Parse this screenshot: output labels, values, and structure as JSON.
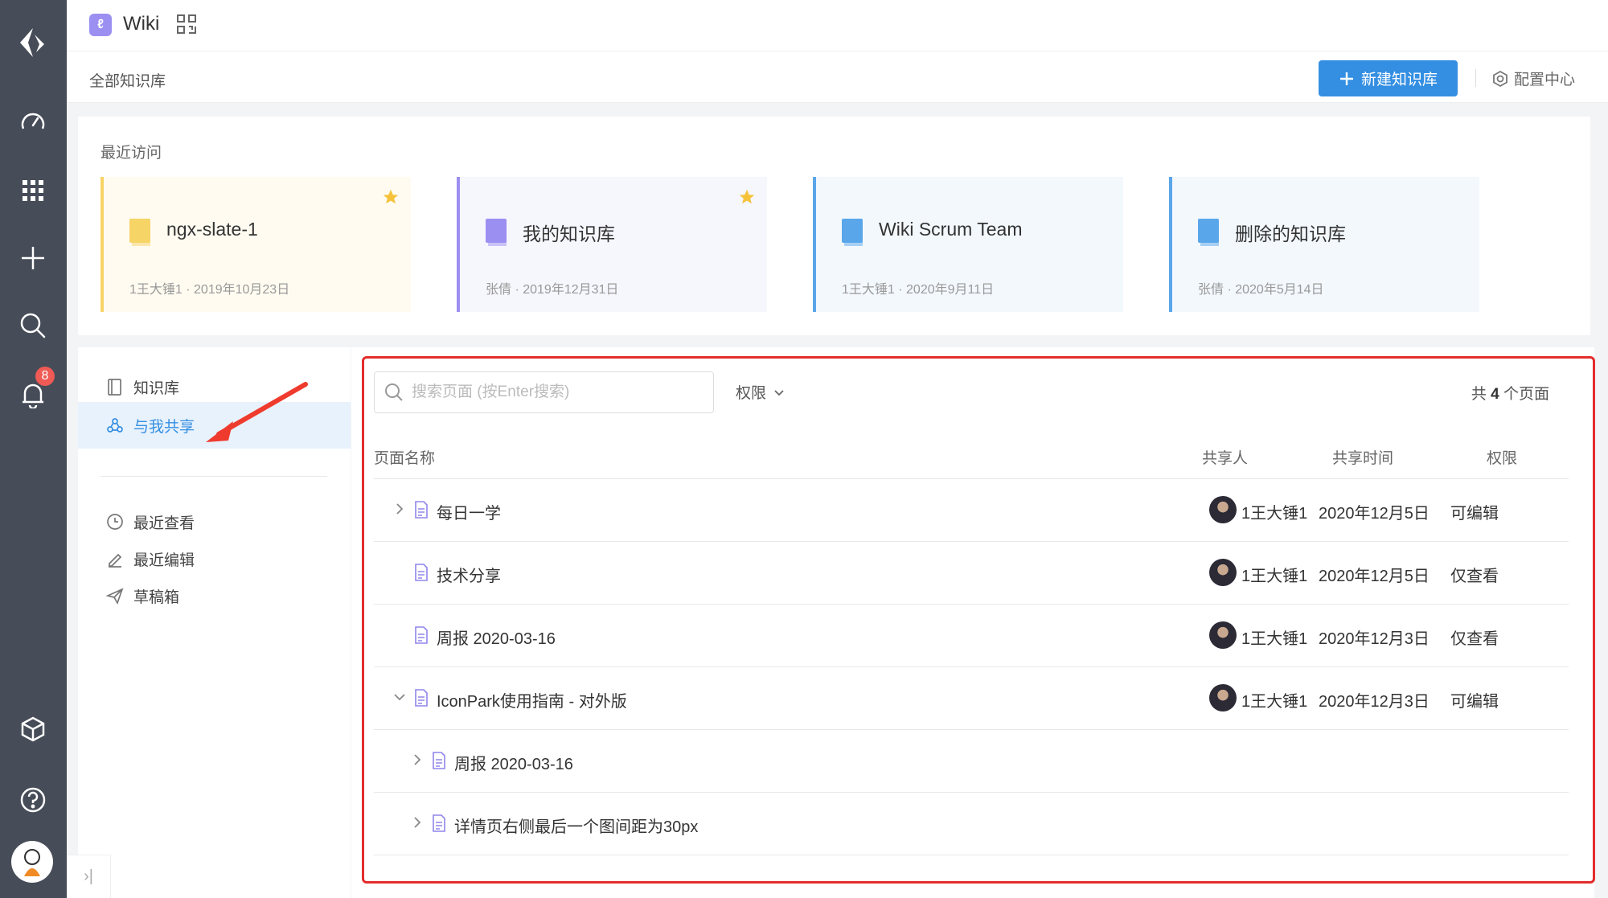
{
  "app": {
    "title": "Wiki"
  },
  "rail": {
    "badge_count": "8"
  },
  "subbar": {
    "title": "全部知识库",
    "new_button": "新建知识库",
    "config": "配置中心"
  },
  "recent": {
    "title": "最近访问",
    "cards": [
      {
        "name": "ngx-slate-1",
        "meta": "1王大锤1 · 2019年10月23日",
        "starred": true,
        "accent": "#f7d466",
        "bg": "#fffbf0"
      },
      {
        "name": "我的知识库",
        "meta": "张倩 · 2019年12月31日",
        "starred": true,
        "accent": "#9b8ff2",
        "bg": "#f6f6fd"
      },
      {
        "name": "Wiki Scrum Team",
        "meta": "1王大锤1 · 2020年9月11日",
        "starred": false,
        "accent": "#5aa6ea",
        "bg": "#f3f8fd"
      },
      {
        "name": "删除的知识库",
        "meta": "张倩 · 2020年5月14日",
        "starred": false,
        "accent": "#5aa6ea",
        "bg": "#f3f8fd"
      }
    ]
  },
  "nav": {
    "items": [
      {
        "label": "知识库",
        "icon": "book-icon",
        "active": false
      },
      {
        "label": "与我共享",
        "icon": "share-icon",
        "active": true
      },
      {
        "label": "最近查看",
        "icon": "clock-icon",
        "active": false
      },
      {
        "label": "最近编辑",
        "icon": "edit-icon",
        "active": false
      },
      {
        "label": "草稿箱",
        "icon": "send-icon",
        "active": false
      }
    ]
  },
  "list": {
    "search_placeholder": "搜索页面 (按Enter搜索)",
    "permission_filter": "权限",
    "total_prefix": "共",
    "total_count": "4",
    "total_suffix": "个页面",
    "columns": {
      "name": "页面名称",
      "sharer": "共享人",
      "time": "共享时间",
      "permission": "权限"
    },
    "rows": [
      {
        "title": "每日一学",
        "chevron": "right",
        "level": 0,
        "sharer": "1王大锤1",
        "time": "2020年12月5日",
        "permission": "可编辑"
      },
      {
        "title": "技术分享",
        "chevron": "none",
        "level": 0,
        "sharer": "1王大锤1",
        "time": "2020年12月5日",
        "permission": "仅查看"
      },
      {
        "title": "周报 2020-03-16",
        "chevron": "none",
        "level": 0,
        "sharer": "1王大锤1",
        "time": "2020年12月3日",
        "permission": "仅查看"
      },
      {
        "title": "IconPark使用指南 - 对外版",
        "chevron": "down",
        "level": 0,
        "sharer": "1王大锤1",
        "time": "2020年12月3日",
        "permission": "可编辑"
      },
      {
        "title": "周报 2020-03-16",
        "chevron": "right",
        "level": 1,
        "sharer": "",
        "time": "",
        "permission": ""
      },
      {
        "title": "详情页右侧最后一个图间距为30px",
        "chevron": "right",
        "level": 1,
        "sharer": "",
        "time": "",
        "permission": ""
      }
    ]
  },
  "colors": {
    "primary": "#348fe2",
    "rail": "#464c58",
    "highlight": "#e32d2d",
    "annotation_arrow": "#ef3b2d"
  }
}
